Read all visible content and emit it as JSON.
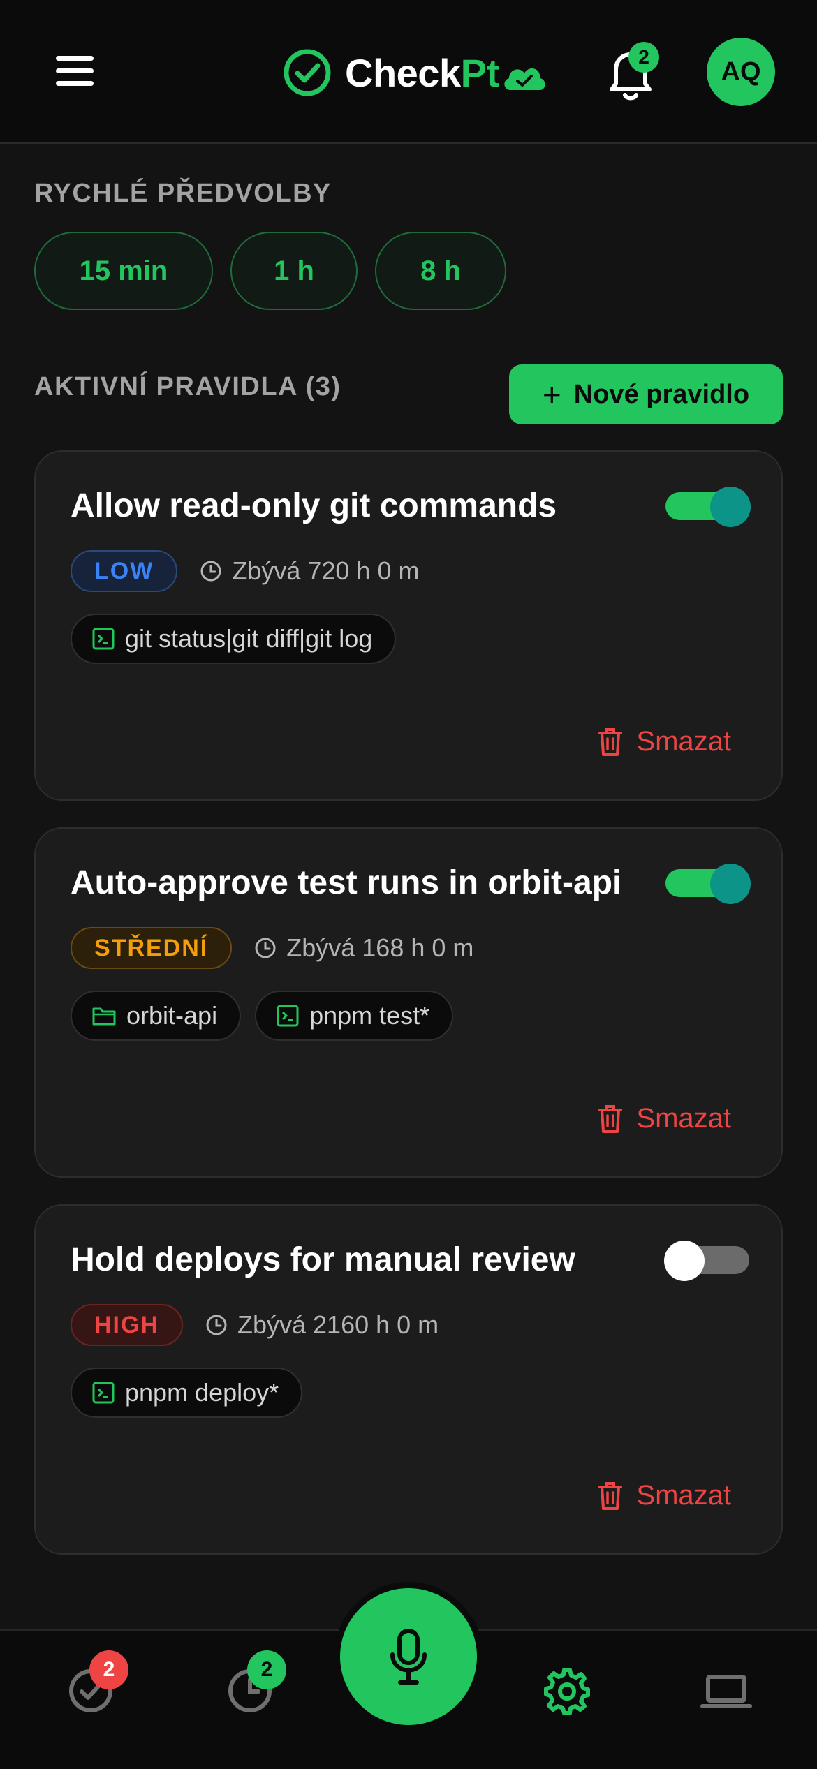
{
  "header": {
    "logo_text_1": "Check",
    "logo_text_2": "Pt",
    "notification_count": "2",
    "avatar_initials": "AQ"
  },
  "quick_presets": {
    "title": "RYCHLÉ PŘEDVOLBY",
    "items": [
      "15 min",
      "1 h",
      "8 h"
    ]
  },
  "rules_section": {
    "title": "AKTIVNÍ PRAVIDLA (3)",
    "new_rule_label": "Nové pravidlo"
  },
  "rules": [
    {
      "title": "Allow read-only git commands",
      "enabled": true,
      "risk": "LOW",
      "remaining": "Zbývá 720 h 0 m",
      "chips": [
        {
          "icon": "terminal-icon",
          "text": "git status|git diff|git log"
        }
      ],
      "delete_label": "Smazat"
    },
    {
      "title": "Auto-approve test runs in orbit-api",
      "enabled": true,
      "risk": "STŘEDNÍ",
      "remaining": "Zbývá 168 h 0 m",
      "chips": [
        {
          "icon": "folder-icon",
          "text": "orbit-api"
        },
        {
          "icon": "terminal-icon",
          "text": "pnpm test*"
        }
      ],
      "delete_label": "Smazat"
    },
    {
      "title": "Hold deploys for manual review",
      "enabled": false,
      "risk": "HIGH",
      "remaining": "Zbývá 2160 h 0 m",
      "chips": [
        {
          "icon": "terminal-icon",
          "text": "pnpm deploy*"
        }
      ],
      "delete_label": "Smazat"
    }
  ],
  "bottom_nav": {
    "approvals_badge": "2",
    "history_badge": "2",
    "items": [
      "check-circle-icon",
      "history-icon",
      "microphone-icon",
      "gear-icon",
      "laptop-icon"
    ]
  },
  "colors": {
    "accent": "#22c55e",
    "background": "#131313",
    "card": "#1c1c1c",
    "low": "#3b82f6",
    "medium": "#f59e0b",
    "high": "#ef4444",
    "danger": "#ef4444",
    "toggle_knob_on": "#0d9488"
  }
}
